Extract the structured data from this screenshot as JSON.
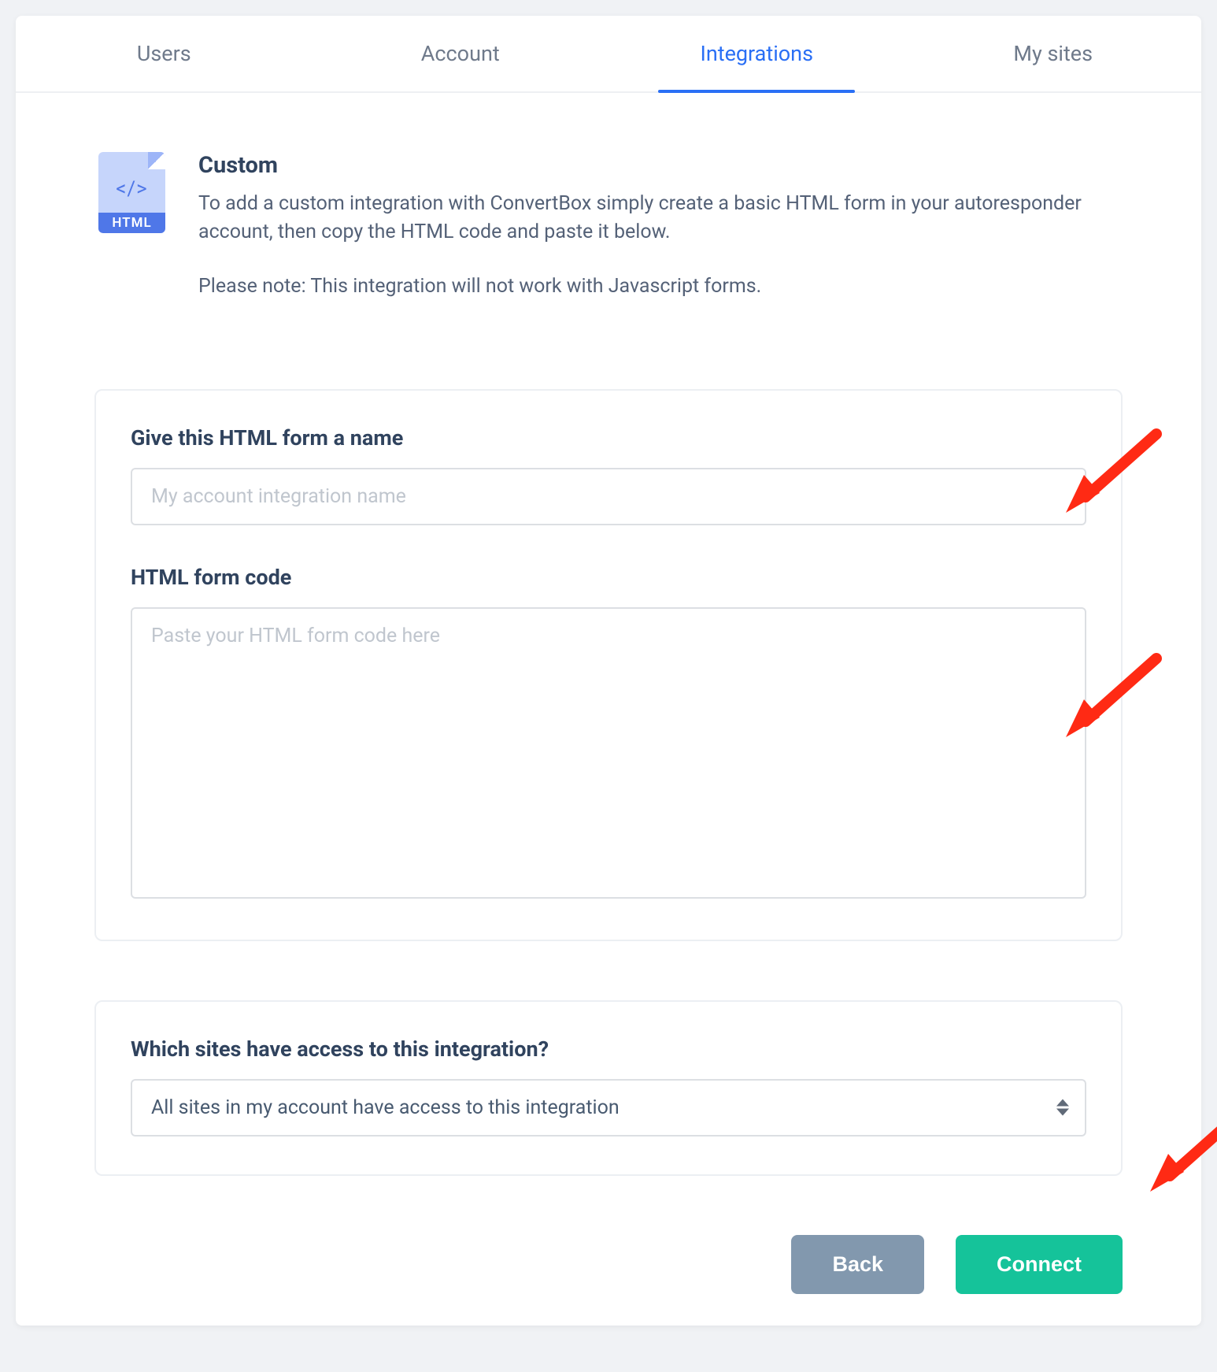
{
  "tabs": [
    {
      "label": "Users",
      "active": false
    },
    {
      "label": "Account",
      "active": false
    },
    {
      "label": "Integrations",
      "active": true
    },
    {
      "label": "My sites",
      "active": false
    }
  ],
  "intro": {
    "icon_code": "</>",
    "icon_badge": "HTML",
    "title": "Custom",
    "desc": "To add a custom integration with ConvertBox simply create a basic HTML form in your autoresponder account, then copy the HTML code and paste it below.",
    "note": "Please note: This integration will not work with Javascript forms."
  },
  "form": {
    "name_label": "Give this HTML form a name",
    "name_placeholder": "My account integration name",
    "code_label": "HTML form code",
    "code_placeholder": "Paste your HTML form code here"
  },
  "access": {
    "label": "Which sites have access to this integration?",
    "selected": "All sites in my account have access to this integration"
  },
  "buttons": {
    "back": "Back",
    "connect": "Connect"
  }
}
